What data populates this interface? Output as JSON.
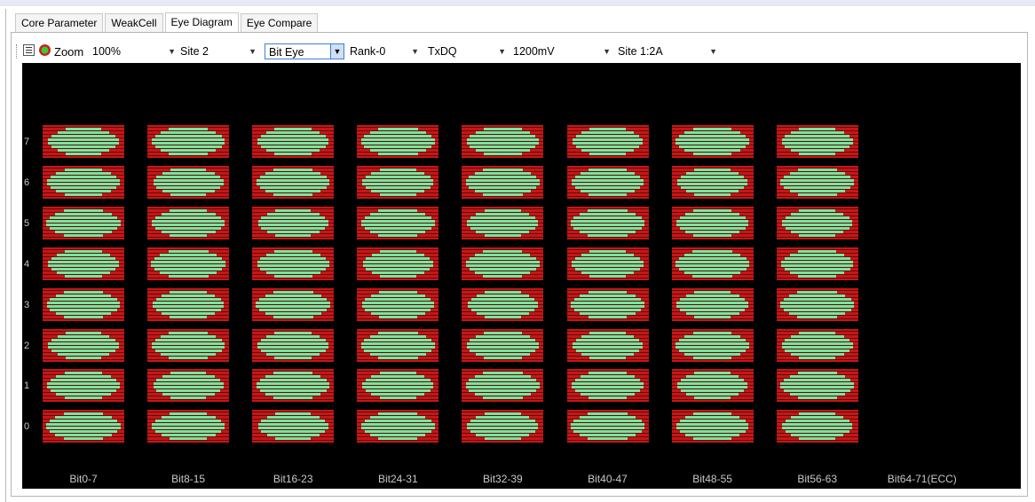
{
  "tabs": [
    {
      "label": "Core Parameter",
      "active": false
    },
    {
      "label": "WeakCell",
      "active": false
    },
    {
      "label": "Eye Diagram",
      "active": true
    },
    {
      "label": "Eye Compare",
      "active": false
    }
  ],
  "toolbar": {
    "zoom_label": "Zoom",
    "zoom_value": "100%",
    "site": "Site 2",
    "mode": "Bit Eye",
    "rank": "Rank-0",
    "signal": "TxDQ",
    "voltage": "1200mV",
    "site_slot": "Site 1:2A"
  },
  "colors": {
    "fail": "#c81616",
    "pass": "#7fe29c",
    "background": "#000000"
  },
  "eye_diagram": {
    "row_labels": [
      "7",
      "6",
      "5",
      "4",
      "3",
      "2",
      "1",
      "0"
    ],
    "column_labels": [
      "Bit0-7",
      "Bit8-15",
      "Bit16-23",
      "Bit24-31",
      "Bit32-39",
      "Bit40-47",
      "Bit48-55",
      "Bit56-63",
      "Bit64-71(ECC)"
    ],
    "populated_columns": 8
  }
}
